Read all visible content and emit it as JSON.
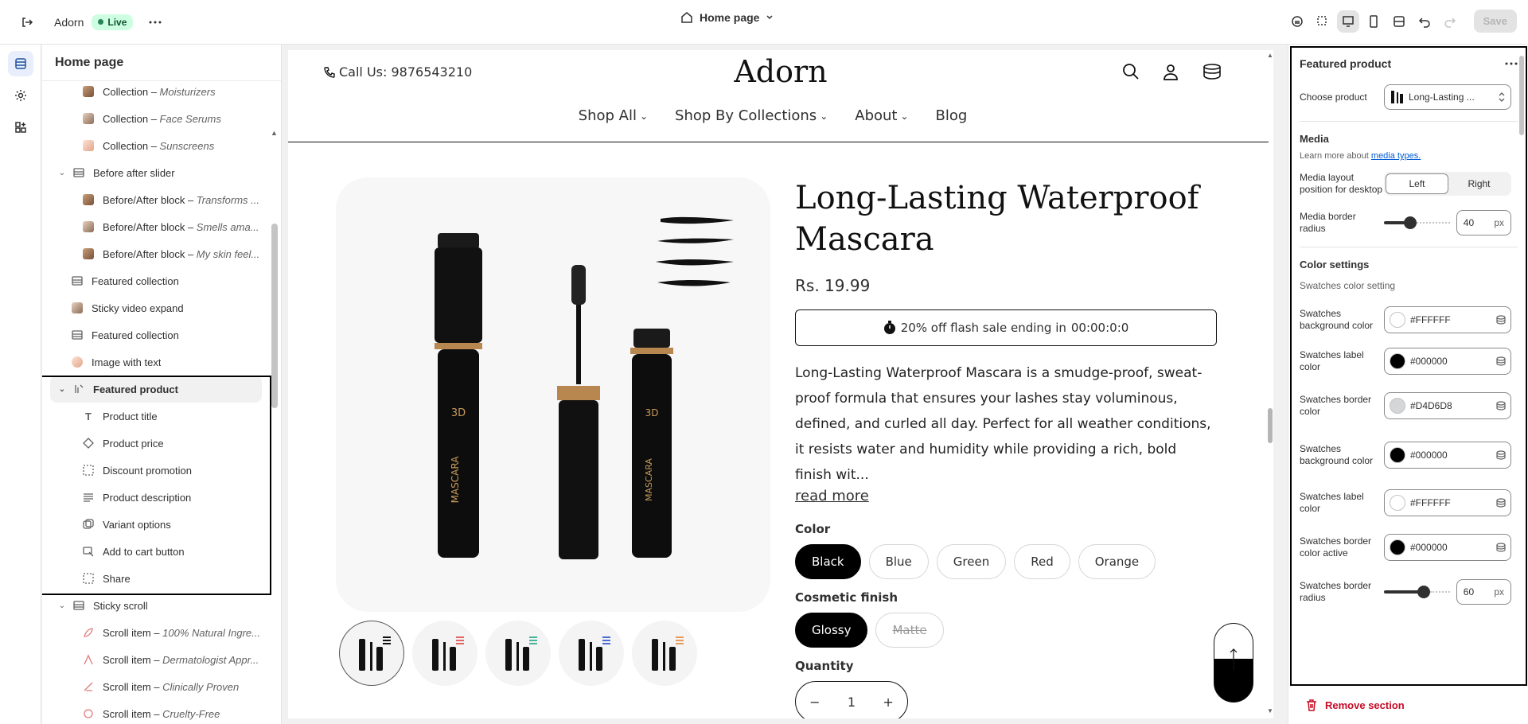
{
  "topbar": {
    "store_name": "Adorn",
    "live_label": "Live",
    "page_selector": "Home page",
    "save_label": "Save"
  },
  "sidebar": {
    "title": "Home page",
    "items": [
      {
        "label": "Collection – ",
        "sub": "Moisturizers"
      },
      {
        "label": "Collection – ",
        "sub": "Face Serums"
      },
      {
        "label": "Collection – ",
        "sub": "Sunscreens"
      },
      {
        "label": "Before after slider",
        "sub": ""
      },
      {
        "label": "Before/After block – ",
        "sub": "Transforms ..."
      },
      {
        "label": "Before/After block – ",
        "sub": "Smells ama..."
      },
      {
        "label": "Before/After block – ",
        "sub": "My skin feel..."
      },
      {
        "label": "Featured collection",
        "sub": ""
      },
      {
        "label": "Sticky video expand",
        "sub": ""
      },
      {
        "label": "Featured collection",
        "sub": ""
      },
      {
        "label": "Image with text",
        "sub": ""
      },
      {
        "label": "Featured product",
        "sub": ""
      },
      {
        "label": "Product title",
        "sub": ""
      },
      {
        "label": "Product price",
        "sub": ""
      },
      {
        "label": "Discount promotion",
        "sub": ""
      },
      {
        "label": "Product description",
        "sub": ""
      },
      {
        "label": "Variant options",
        "sub": ""
      },
      {
        "label": "Add to cart button",
        "sub": ""
      },
      {
        "label": "Share",
        "sub": ""
      },
      {
        "label": "Sticky scroll",
        "sub": ""
      },
      {
        "label": "Scroll item – ",
        "sub": "100% Natural Ingre..."
      },
      {
        "label": "Scroll item – ",
        "sub": "Dermatologist Appr..."
      },
      {
        "label": "Scroll item – ",
        "sub": "Clinically Proven"
      },
      {
        "label": "Scroll item – ",
        "sub": "Cruelty-Free"
      }
    ]
  },
  "preview": {
    "call": "Call Us: 9876543210",
    "brand": "Adorn",
    "nav": [
      "Shop All",
      "Shop By Collections",
      "About",
      "Blog"
    ],
    "product_title": "Long-Lasting Waterproof Mascara",
    "price": "Rs. 19.99",
    "flash_text": "20% off flash sale ending in",
    "flash_timer": "00:00:0:0",
    "description": "Long-Lasting Waterproof Mascara is a smudge-proof, sweat-proof formula that ensures your lashes stay voluminous, defined, and curled all day. Perfect for all weather conditions, it resists water and humidity while providing a rich, bold finish wit...",
    "read_more": "read more",
    "color_label": "Color",
    "colors": [
      "Black",
      "Blue",
      "Green",
      "Red",
      "Orange"
    ],
    "finish_label": "Cosmetic finish",
    "finishes": [
      "Glossy",
      "Matte"
    ],
    "quantity_label": "Quantity",
    "quantity": "1",
    "mascara_text": "MASCARA",
    "mascara_badge": "3D"
  },
  "settings": {
    "title": "Featured product",
    "choose_product_label": "Choose product",
    "choose_product_value": "Long-Lasting ...",
    "media_title": "Media",
    "media_help": "Learn more about",
    "media_link": "media types.",
    "layout_label": "Media layout position for desktop",
    "layout_left": "Left",
    "layout_right": "Right",
    "radius_label": "Media border radius",
    "radius_value": "40",
    "radius_level": 0.4,
    "unit": "px",
    "color_title": "Color settings",
    "swatch_setting": "Swatches color setting",
    "colors": [
      {
        "label": "Swatches background color",
        "hex": "#FFFFFF",
        "swatch": "#ffffff"
      },
      {
        "label": "Swatches label color",
        "hex": "#000000",
        "swatch": "#000000"
      },
      {
        "label": "Swatches border color",
        "hex": "#D4D6D8",
        "swatch": "#d4d6d8"
      },
      {
        "label": "Swatches background color",
        "hex": "#000000",
        "swatch": "#000000"
      },
      {
        "label": "Swatches label color",
        "hex": "#FFFFFF",
        "swatch": "#ffffff"
      },
      {
        "label": "Swatches border color active",
        "hex": "#000000",
        "swatch": "#000000"
      }
    ],
    "swatch_radius_label": "Swatches border radius",
    "swatch_radius_value": "60",
    "swatch_radius_level": 0.6,
    "remove_label": "Remove section"
  }
}
